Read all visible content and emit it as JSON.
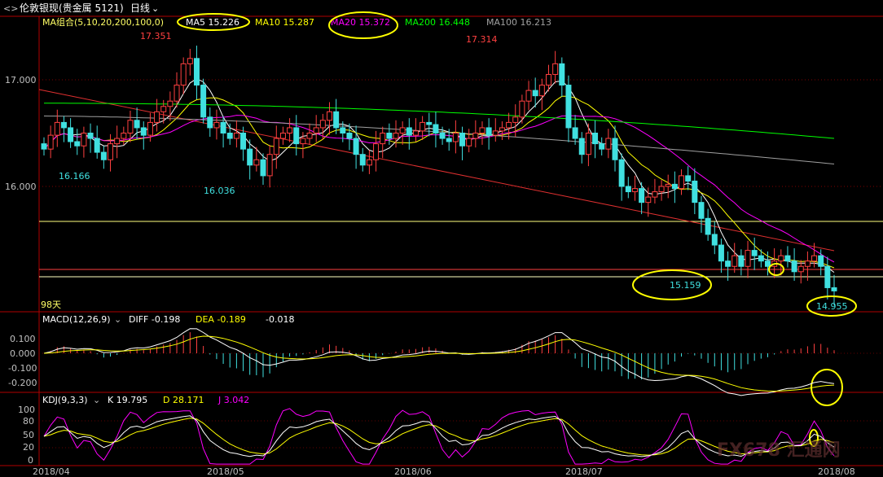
{
  "header": {
    "title": "伦敦银现(贵金属 5121)",
    "period": "日线",
    "ma_group_label": "MA组合(5,10,20,200,100,0)",
    "ma_items": [
      {
        "label": "MA5 15.226",
        "color": "#ffffff"
      },
      {
        "label": "MA10 15.287",
        "color": "#ffff00"
      },
      {
        "label": "MA20 15.372",
        "color": "#ff00ff"
      },
      {
        "label": "MA200 16.448",
        "color": "#00ff00"
      },
      {
        "label": "MA100 16.213",
        "color": "#a0a0a0"
      }
    ]
  },
  "price_panel": {
    "y_ticks": [
      "17.000",
      "16.000"
    ],
    "annotations": [
      {
        "text": "17.351",
        "color": "#ff4040"
      },
      {
        "text": "17.314",
        "color": "#ff4040"
      },
      {
        "text": "16.166",
        "color": "#40e0e0"
      },
      {
        "text": "16.036",
        "color": "#40e0e0"
      },
      {
        "text": "15.159",
        "color": "#40e0e0"
      },
      {
        "text": "14.955",
        "color": "#40e0e0"
      }
    ],
    "days_label": "98天"
  },
  "macd_panel": {
    "label": "MACD(12,26,9)",
    "diff": "DIFF -0.198",
    "dea": "DEA -0.189",
    "macd": "-0.018",
    "y_ticks": [
      "0.100",
      "0.000",
      "-0.100",
      "-0.200"
    ]
  },
  "kdj_panel": {
    "label": "KDJ(9,3,3)",
    "k": "K 19.795",
    "d": "D 28.171",
    "j": "J 3.042",
    "y_ticks": [
      "100",
      "80",
      "50",
      "20",
      "0"
    ]
  },
  "x_axis": {
    "labels": [
      "2018/04",
      "2018/05",
      "2018/06",
      "2018/07",
      "2018/08"
    ]
  },
  "watermark": "FX678 汇通网",
  "chart_data": {
    "type": "candlestick",
    "close_series": [
      16.35,
      16.48,
      16.6,
      16.55,
      16.42,
      16.38,
      16.5,
      16.45,
      16.32,
      16.25,
      16.4,
      16.45,
      16.5,
      16.62,
      16.55,
      16.48,
      16.6,
      16.7,
      16.75,
      16.8,
      16.95,
      17.15,
      17.2,
      16.95,
      16.65,
      16.55,
      16.6,
      16.5,
      16.45,
      16.5,
      16.35,
      16.2,
      16.25,
      16.1,
      16.3,
      16.45,
      16.5,
      16.55,
      16.4,
      16.45,
      16.5,
      16.55,
      16.62,
      16.7,
      16.55,
      16.5,
      16.45,
      16.3,
      16.2,
      16.25,
      16.4,
      16.5,
      16.45,
      16.5,
      16.55,
      16.48,
      16.52,
      16.6,
      16.58,
      16.5,
      16.45,
      16.42,
      16.5,
      16.38,
      16.45,
      16.5,
      16.55,
      16.48,
      16.52,
      16.55,
      16.6,
      16.65,
      16.8,
      16.9,
      16.85,
      16.95,
      17.05,
      17.15,
      16.95,
      16.55,
      16.45,
      16.3,
      16.5,
      16.4,
      16.35,
      16.45,
      16.25,
      16.0,
      15.95,
      15.98,
      15.85,
      15.9,
      15.95,
      16.0,
      16.02,
      15.98,
      16.1,
      16.05,
      15.85,
      15.7,
      15.55,
      15.45,
      15.3,
      15.25,
      15.35,
      15.25,
      15.4,
      15.35,
      15.3,
      15.25,
      15.3,
      15.35,
      15.3,
      15.2,
      15.25,
      15.3,
      15.35,
      15.25,
      15.05,
      15.02
    ],
    "series": [
      {
        "name": "MA5",
        "value": 15.226
      },
      {
        "name": "MA10",
        "value": 15.287
      },
      {
        "name": "MA20",
        "value": 15.372
      },
      {
        "name": "MA200",
        "value": 16.448
      },
      {
        "name": "MA100",
        "value": 16.213
      }
    ],
    "ylim": [
      14.85,
      17.6
    ]
  }
}
